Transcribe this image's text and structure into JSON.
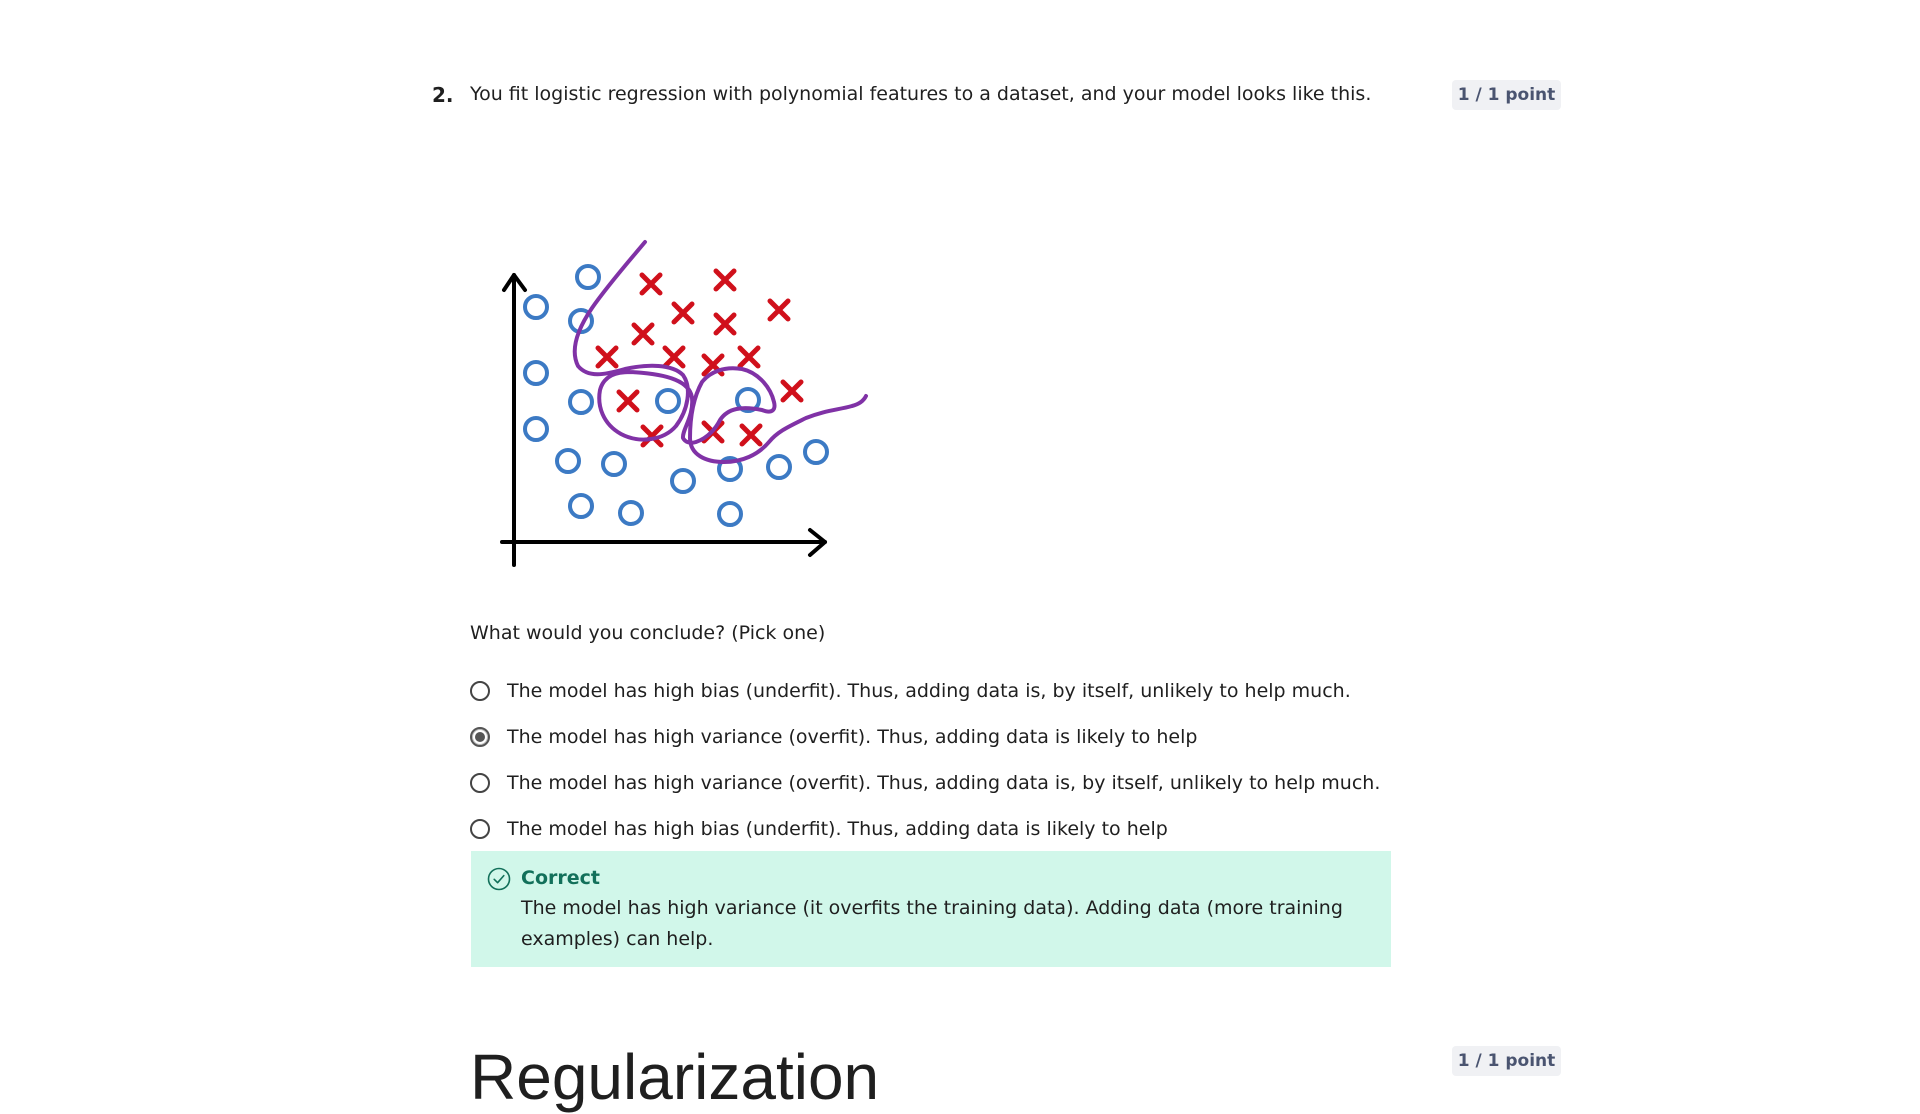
{
  "question": {
    "number": "2.",
    "text": "You fit logistic regression with polynomial features to a dataset, and your model looks like this.",
    "points": "1 / 1 point",
    "prompt": "What would you conclude? (Pick one)",
    "options": [
      {
        "label": "The model has high bias (underfit). Thus, adding data is, by itself, unlikely to help much.",
        "selected": false
      },
      {
        "label": "The model has high variance (overfit). Thus, adding data is likely to help",
        "selected": true
      },
      {
        "label": "The model has high variance (overfit). Thus, adding data is, by itself, unlikely to help much.",
        "selected": false
      },
      {
        "label": "The model has high bias (underfit). Thus, adding data is likely to help",
        "selected": false
      }
    ],
    "feedback": {
      "status": "Correct",
      "message": "The model has high variance (it overfits the training data). Adding data (more training examples) can help.",
      "icon": "check-circle-icon"
    }
  },
  "next_section": {
    "title": "Regularization",
    "points": "1 / 1 point"
  },
  "colors": {
    "correct_bg": "#d1f7ea",
    "correct_text": "#12705a",
    "badge_bg": "#f0f1f4",
    "badge_text": "#4a5470",
    "circle_marker": "#3c7ac4",
    "x_marker": "#d0101b",
    "boundary": "#8032a6"
  }
}
